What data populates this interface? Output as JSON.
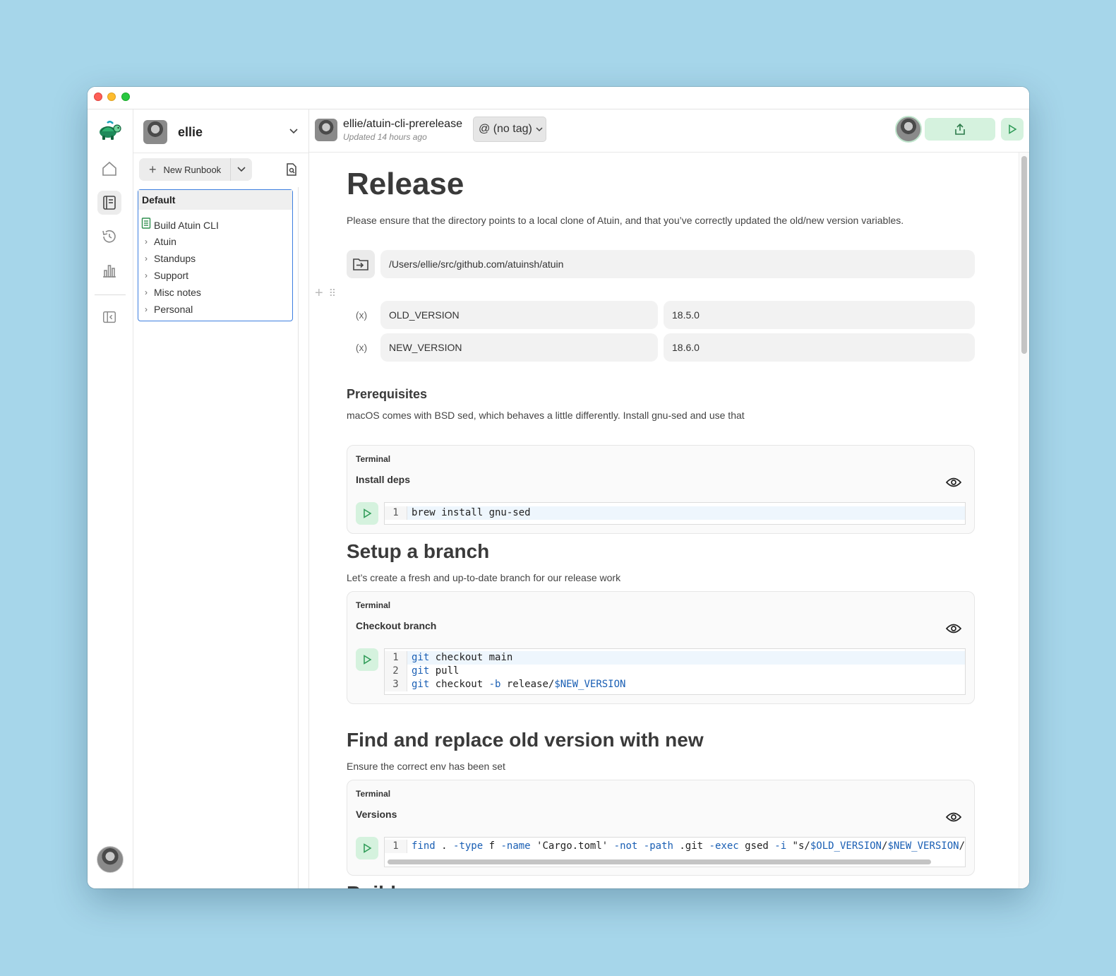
{
  "colors": {
    "background": "#a6d6ea",
    "accent_green": "#d5f2de",
    "selection_blue": "#3d7fe0"
  },
  "sidebar": {
    "user_name": "ellie",
    "new_runbook_label": "New Runbook",
    "tree": {
      "header": "Default",
      "items": [
        {
          "label": "Build Atuin CLI",
          "icon": "runbook-icon"
        },
        {
          "label": "Atuin",
          "icon": "chevron-right-icon"
        },
        {
          "label": "Standups",
          "icon": "chevron-right-icon"
        },
        {
          "label": "Support",
          "icon": "chevron-right-icon"
        },
        {
          "label": "Misc notes",
          "icon": "chevron-right-icon"
        },
        {
          "label": "Personal",
          "icon": "chevron-right-icon"
        }
      ]
    }
  },
  "header": {
    "runbook_path": "ellie/atuin-cli-prerelease",
    "updated": "Updated 14 hours ago",
    "tag_label": "@ (no tag)"
  },
  "doc": {
    "title": "Release",
    "intro": "Please ensure that the directory points to a local clone of Atuin, and that you’ve correctly updated the old/new version variables.",
    "directory": "/Users/ellie/src/github.com/atuinsh/atuin",
    "vars": [
      {
        "name": "OLD_VERSION",
        "value": "18.5.0"
      },
      {
        "name": "NEW_VERSION",
        "value": "18.6.0"
      }
    ],
    "prereq_heading": "Prerequisites",
    "prereq_text": "macOS comes with BSD sed, which behaves a little differently. Install gnu-sed and use that",
    "branch_heading": "Setup a branch",
    "branch_text": "Let’s create a fresh and up-to-date branch for our release work",
    "replace_heading": "Find and replace old version with new",
    "replace_text": "Ensure the correct env has been set",
    "next_heading": "Build",
    "blocks": [
      {
        "type_label": "Terminal",
        "name": "Install deps",
        "lines": [
          "1"
        ],
        "code": [
          "brew install gnu-sed"
        ]
      },
      {
        "type_label": "Terminal",
        "name": "Checkout branch",
        "lines": [
          "1",
          "2",
          "3"
        ],
        "code": [
          "git checkout main",
          "git pull",
          "git checkout -b release/$NEW_VERSION"
        ]
      },
      {
        "type_label": "Terminal",
        "name": "Versions",
        "lines": [
          "1"
        ],
        "code": [
          "find . -type f -name 'Cargo.toml' -not -path .git -exec gsed -i \"s/$OLD_VERSION/$NEW_VERSION/\""
        ]
      }
    ]
  }
}
